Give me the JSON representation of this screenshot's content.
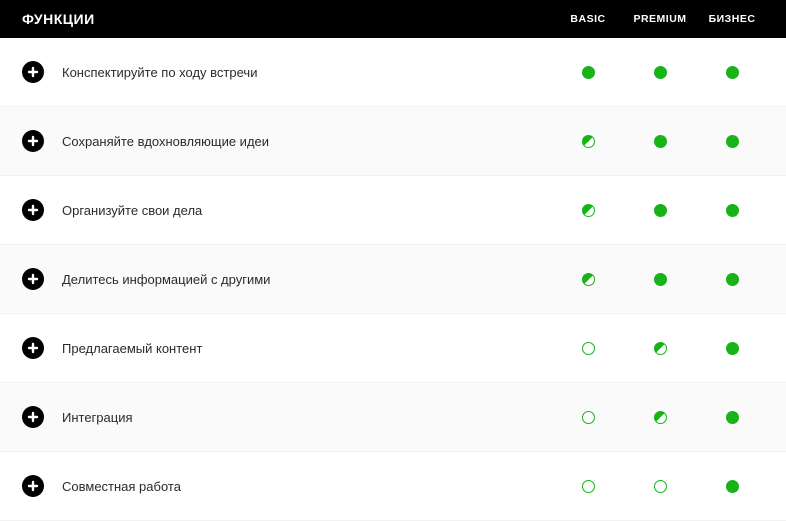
{
  "header": {
    "title": "ФУНКЦИИ",
    "columns": [
      "BASIC",
      "PREMIUM",
      "БИЗНЕС"
    ]
  },
  "features": [
    {
      "label": "Конспектируйте по ходу встречи",
      "levels": [
        "full",
        "full",
        "full"
      ]
    },
    {
      "label": "Сохраняйте вдохновляющие идеи",
      "levels": [
        "half",
        "full",
        "full"
      ]
    },
    {
      "label": "Организуйте свои дела",
      "levels": [
        "half",
        "full",
        "full"
      ]
    },
    {
      "label": "Делитесь информацией с другими",
      "levels": [
        "half",
        "full",
        "full"
      ]
    },
    {
      "label": "Предлагаемый контент",
      "levels": [
        "empty",
        "half",
        "full"
      ]
    },
    {
      "label": "Интеграция",
      "levels": [
        "empty",
        "half",
        "full"
      ]
    },
    {
      "label": "Совместная работа",
      "levels": [
        "empty",
        "empty",
        "full"
      ]
    }
  ]
}
